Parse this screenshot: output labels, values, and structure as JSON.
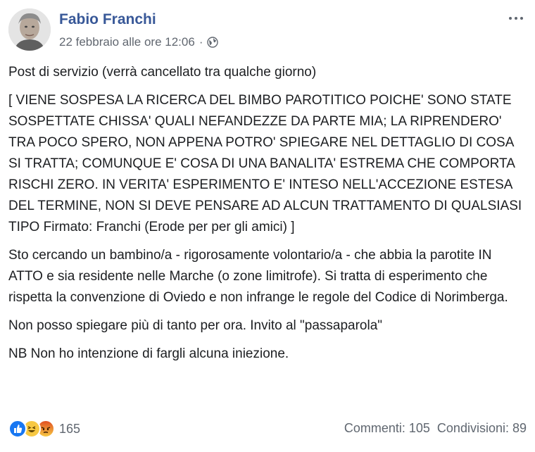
{
  "author": {
    "name": "Fabio Franchi",
    "timestamp": "22 febbraio alle ore 12:06",
    "separator": "·"
  },
  "icons": {
    "privacy": "globe-icon",
    "menu": "more-options-icon",
    "reactions": [
      "like-icon",
      "haha-icon",
      "angry-icon"
    ]
  },
  "post": {
    "paragraphs": [
      "Post di servizio (verrà cancellato tra qualche giorno)",
      "[ VIENE SOSPESA LA RICERCA DEL BIMBO PAROTITICO POICHE' SONO STATE SOSPETTATE CHISSA' QUALI NEFANDEZZE DA PARTE MIA; LA RIPRENDERO' TRA POCO SPERO, NON APPENA POTRO' SPIEGARE NEL DETTAGLIO DI COSA SI TRATTA; COMUNQUE E' COSA DI UNA BANALITA' ESTREMA CHE COMPORTA RISCHI ZERO. IN VERITA' ESPERIMENTO E' INTESO NELL'ACCEZIONE ESTESA DEL TERMINE, NON SI DEVE PENSARE AD ALCUN TRATTAMENTO DI QUALSIASI TIPO Firmato: Franchi (Erode per per gli amici) ]",
      "Sto cercando un bambino/a - rigorosamente volontario/a - che abbia la parotite IN ATTO e sia residente nelle Marche (o zone limitrofe). Si tratta di esperimento che rispetta la convenzione di Oviedo e non infrange le regole del Codice di Norimberga.",
      "Non posso spiegare più di tanto per ora. Invito al \"passaparola\"",
      "NB Non ho intenzione di fargli alcuna iniezione."
    ]
  },
  "footer": {
    "reaction_count": "165",
    "comments": "Commenti: 105",
    "shares": "Condivisioni: 89"
  },
  "colors": {
    "name": "#385898",
    "meta": "#616770",
    "text": "#1c1e21",
    "like": "#1877f2",
    "haha": "#f7c843",
    "angry": "#e9710f"
  }
}
